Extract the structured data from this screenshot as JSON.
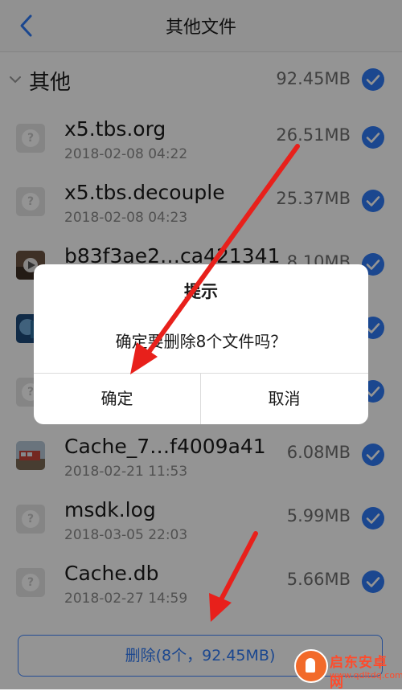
{
  "nav": {
    "title": "其他文件",
    "back_icon": "chevron-left-icon"
  },
  "group": {
    "name": "其他",
    "size": "92.45MB",
    "checked": true
  },
  "files": [
    {
      "name": "x5.tbs.org",
      "date": "2018-02-08 04:22",
      "size": "26.51MB",
      "thumb": "generic-file-icon"
    },
    {
      "name": "x5.tbs.decouple",
      "date": "2018-02-08 04:23",
      "size": "25.37MB",
      "thumb": "generic-file-icon"
    },
    {
      "name": "b83f3ae2…ca421341",
      "date": "",
      "size": "8.10MB",
      "thumb": "video-thumbnail"
    },
    {
      "name": "",
      "date": "",
      "size": "",
      "thumb": "image-thumbnail"
    },
    {
      "name": "",
      "date": "",
      "size": "",
      "thumb": "generic-file-icon"
    },
    {
      "name": "Cache_7…f4009a41",
      "date": "2018-02-21 11:53",
      "size": "6.08MB",
      "thumb": "photo-thumbnail"
    },
    {
      "name": "msdk.log",
      "date": "2018-03-05 22:03",
      "size": "5.99MB",
      "thumb": "generic-file-icon"
    },
    {
      "name": "Cache.db",
      "date": "2018-02-27 14:59",
      "size": "5.66MB",
      "thumb": "generic-file-icon"
    }
  ],
  "delete_button": {
    "label": "删除(8个，92.45MB)"
  },
  "dialog": {
    "title": "提示",
    "message": "确定要删除8个文件吗？",
    "confirm": "确定",
    "cancel": "取消"
  },
  "watermark": {
    "name": "启东安卓网",
    "url": "www.qdltdq.com"
  },
  "colors": {
    "accent": "#2f7af6",
    "arrow": "#e8201b",
    "check": "#2f7af6"
  }
}
